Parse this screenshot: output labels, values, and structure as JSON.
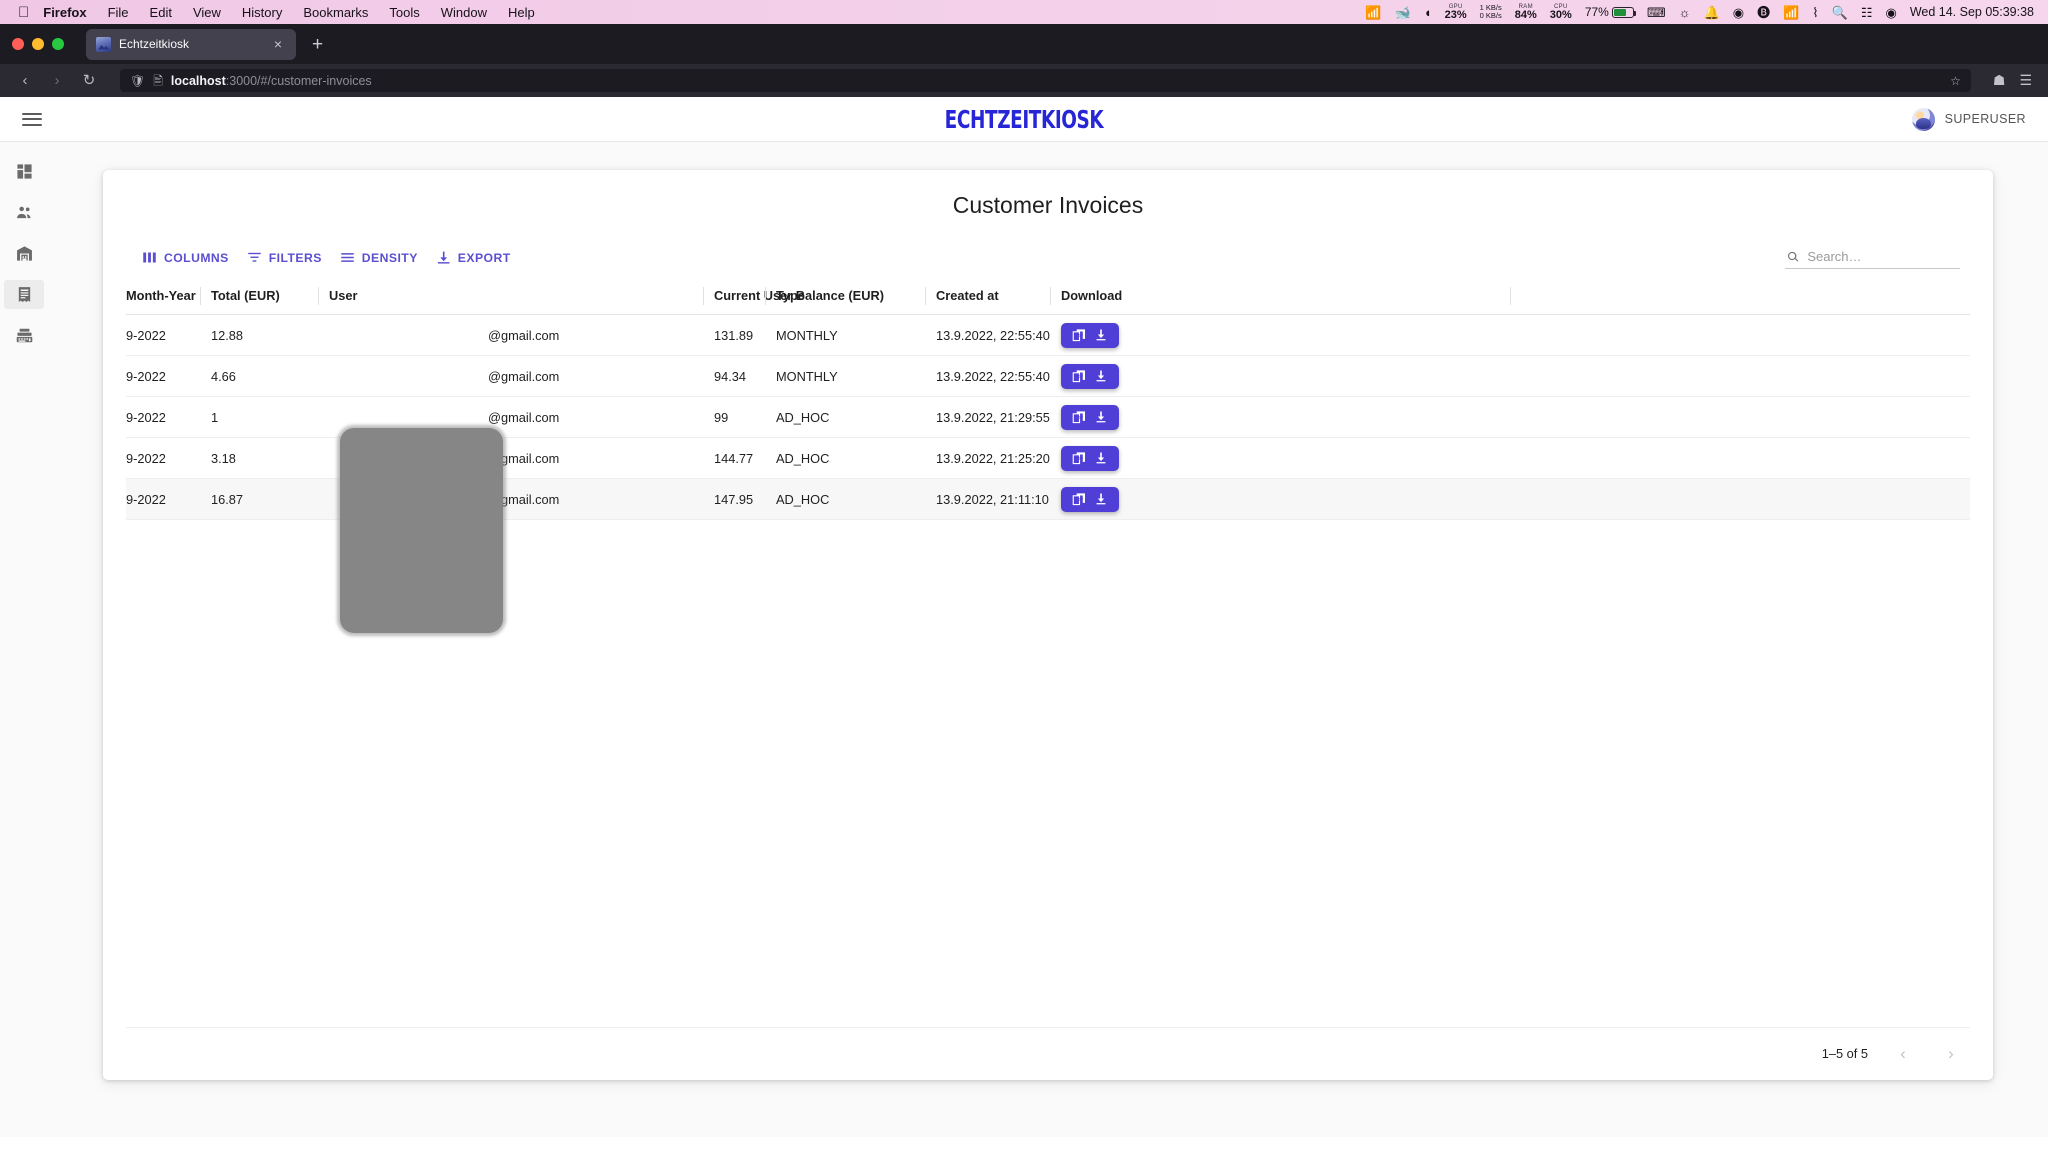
{
  "menubar": {
    "apple": "apple-logo",
    "items": [
      {
        "label": "Firefox",
        "bold": true
      },
      {
        "label": "File",
        "bold": false
      },
      {
        "label": "Edit",
        "bold": false
      },
      {
        "label": "View",
        "bold": false
      },
      {
        "label": "History",
        "bold": false
      },
      {
        "label": "Bookmarks",
        "bold": false
      },
      {
        "label": "Tools",
        "bold": false
      },
      {
        "label": "Window",
        "bold": false
      },
      {
        "label": "Help",
        "bold": false
      }
    ],
    "status": {
      "gpu_label": "GPU",
      "gpu_value": "23%",
      "net_down": "1 KB/s",
      "net_up": "0 KB/s",
      "ram_label": "RAM",
      "ram_value": "84%",
      "cpu_label": "CPU",
      "cpu_value": "30%",
      "battery": "77%",
      "clock": "Wed 14. Sep  05:39:38"
    }
  },
  "browser": {
    "tab": {
      "title": "Echtzeitkiosk",
      "close": "×"
    },
    "new_tab": "+",
    "nav": {
      "back": "‹",
      "forward": "›",
      "reload": "↻"
    },
    "url": {
      "host": "localhost",
      "rest": ":3000/#/customer-invoices"
    },
    "bookmark_star": "☆"
  },
  "app": {
    "brand": "ECHTZEITKIOSK",
    "user": "SUPERUSER",
    "sidebar": [
      {
        "name": "dashboard",
        "active": false
      },
      {
        "name": "users",
        "active": false
      },
      {
        "name": "warehouse",
        "active": false
      },
      {
        "name": "invoices",
        "active": true
      },
      {
        "name": "register",
        "active": false
      }
    ]
  },
  "page": {
    "title": "Customer Invoices",
    "toolbar": {
      "columns": "COLUMNS",
      "filters": "FILTERS",
      "density": "DENSITY",
      "export": "EXPORT"
    },
    "search": {
      "value": "",
      "placeholder": "Search…"
    },
    "columns": [
      "Month-Year",
      "Total (EUR)",
      "User",
      "Current User Balance (EUR)",
      "Type",
      "Created at",
      "Download"
    ],
    "rows": [
      {
        "month_year": "9-2022",
        "total": "12.88",
        "user": "@gmail.com",
        "balance": "131.89",
        "type": "MONTHLY",
        "created_at": "13.9.2022, 22:55:40",
        "download": "download-pdf"
      },
      {
        "month_year": "9-2022",
        "total": "4.66",
        "user": "@gmail.com",
        "balance": "94.34",
        "type": "MONTHLY",
        "created_at": "13.9.2022, 22:55:40",
        "download": "download-pdf"
      },
      {
        "month_year": "9-2022",
        "total": "1",
        "user": "@gmail.com",
        "balance": "99",
        "type": "AD_HOC",
        "created_at": "13.9.2022, 21:29:55",
        "download": "download-pdf"
      },
      {
        "month_year": "9-2022",
        "total": "3.18",
        "user": "@gmail.com",
        "balance": "144.77",
        "type": "AD_HOC",
        "created_at": "13.9.2022, 21:25:20",
        "download": "download-pdf"
      },
      {
        "month_year": "9-2022",
        "total": "16.87",
        "user": "@gmail.com",
        "balance": "147.95",
        "type": "AD_HOC",
        "created_at": "13.9.2022, 21:11:10",
        "download": "download-pdf"
      }
    ],
    "pagination": {
      "count": "1–5 of 5",
      "prev": "‹",
      "next": "›"
    }
  },
  "colors": {
    "accent": "#5b4fcf",
    "button": "#4f3fd6",
    "brand": "#2626d6",
    "menubar": "#f3cfe9"
  }
}
